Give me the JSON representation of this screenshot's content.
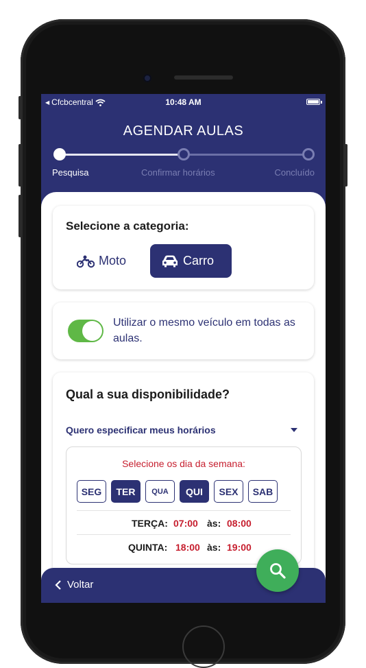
{
  "status": {
    "carrier": "Cfcbcentral",
    "time": "10:48 AM"
  },
  "header": {
    "title": "AGENDAR AULAS",
    "progress": 0.5,
    "steps": [
      "Pesquisa",
      "Confirmar horários",
      "Concluído"
    ]
  },
  "category": {
    "label": "Selecione a categoria:",
    "options": [
      {
        "label": "Moto",
        "icon": "motorcycle-icon",
        "selected": false
      },
      {
        "label": "Carro",
        "icon": "car-icon",
        "selected": true
      }
    ]
  },
  "vehicle": {
    "toggle_on": true,
    "text": "Utilizar o mesmo veículo em todas as aulas."
  },
  "availability": {
    "question": "Qual a sua disponibilidade?",
    "dropdown": "Quero especificar meus horários",
    "hint": "Selecione os dia da semana:",
    "days": [
      {
        "label": "SEG",
        "selected": false
      },
      {
        "label": "TER",
        "selected": true
      },
      {
        "label": "QUA",
        "selected": false
      },
      {
        "label": "QUI",
        "selected": true
      },
      {
        "label": "SEX",
        "selected": false
      },
      {
        "label": "SAB",
        "selected": false
      }
    ],
    "schedules": [
      {
        "day": "TERÇA:",
        "from": "07:00",
        "sep": "às:",
        "to": "08:00"
      },
      {
        "day": "QUINTA:",
        "from": "18:00",
        "sep": "às:",
        "to": "19:00"
      }
    ]
  },
  "footer": {
    "back": "Voltar"
  },
  "colors": {
    "primary": "#2c3173",
    "accent_red": "#c61e2e",
    "green": "#3fae5a"
  }
}
